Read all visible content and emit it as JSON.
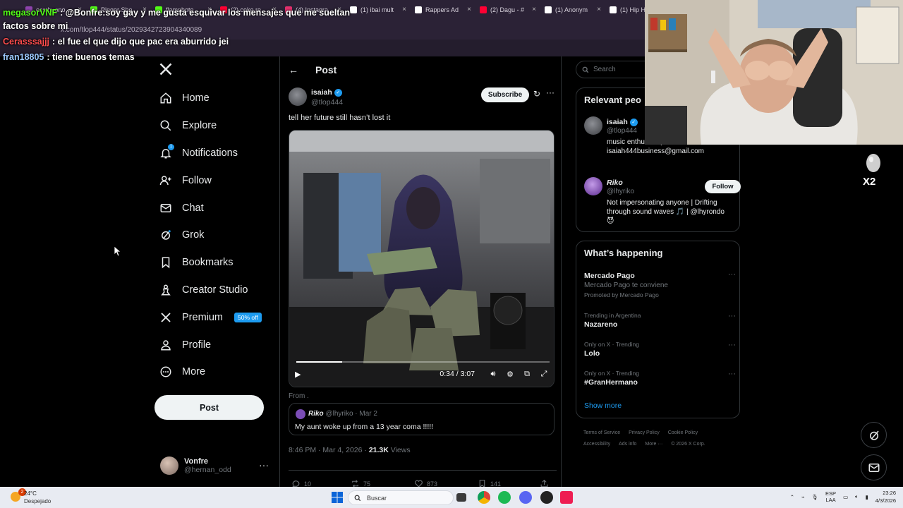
{
  "browser": {
    "tabs": [
      {
        "label": "ecstbuono",
        "color": "#8e44ad"
      },
      {
        "label": "Pinger Sho",
        "color": "#53fc18"
      },
      {
        "label": "flamphoto",
        "color": "#53fc18"
      },
      {
        "label": "(2) coke re",
        "color": "#ff0033"
      },
      {
        "label": "(4) Instagra",
        "color": "#e1306c"
      },
      {
        "label": "(1) ibai mult",
        "color": "#ffffff"
      },
      {
        "label": "Rappers Ad",
        "color": "#ffffff"
      },
      {
        "label": "(2) Dagu - #",
        "color": "#ff0033"
      },
      {
        "label": "(1) Anonym",
        "color": "#ffffff"
      },
      {
        "label": "(1) Hip Ho",
        "color": "#ffffff"
      }
    ],
    "url": "x.com/tlop444/status/2029342723904340089"
  },
  "chat": [
    {
      "user": "megasorVNF",
      "user_color": "#53fc18",
      "text": ": @Bonfre:soy gay y me gusta esquivar los mensajes que me sueltan factos sobre mi"
    },
    {
      "user": "Cerasssajjj",
      "user_color": "#ff4d4d",
      "text": ": el fue el que dijo que pac era aburrido jei"
    },
    {
      "user": "fran18805",
      "user_color": "#9ecbff",
      "text": ": tiene buenos temas"
    }
  ],
  "sidebar": {
    "items": [
      {
        "label": "Home",
        "icon": "home-icon"
      },
      {
        "label": "Explore",
        "icon": "search-icon"
      },
      {
        "label": "Notifications",
        "icon": "bell-icon",
        "badge": "1"
      },
      {
        "label": "Follow",
        "icon": "add-person-icon"
      },
      {
        "label": "Chat",
        "icon": "mail-icon"
      },
      {
        "label": "Grok",
        "icon": "grok-icon"
      },
      {
        "label": "Bookmarks",
        "icon": "bookmark-icon"
      },
      {
        "label": "Creator Studio",
        "icon": "creator-icon"
      },
      {
        "label": "Premium",
        "icon": "x-icon",
        "badge": "50% off"
      },
      {
        "label": "Profile",
        "icon": "person-icon"
      },
      {
        "label": "More",
        "icon": "more-circle-icon"
      }
    ],
    "post_label": "Post",
    "account": {
      "name": "Vonfre",
      "handle": "@hernan_odd"
    }
  },
  "post": {
    "header_title": "Post",
    "author_name": "isaiah",
    "author_handle": "@tlop444",
    "subscribe_label": "Subscribe",
    "text": "tell her future still hasn’t lost it",
    "video": {
      "time": "0:34 / 3:07",
      "progress": 0.18
    },
    "from_label": "From .",
    "quote": {
      "name": "Riko",
      "handle": "@lhyriko",
      "date": "· Mar 2",
      "text": "My aunt woke up from a 13 year coma !!!!!"
    },
    "meta_time": "8:46 PM · Mar 4, 2026 · ",
    "views_count": "21.3K",
    "views_label": " Views",
    "replies": "10",
    "reposts": "75",
    "likes": "873",
    "bookmarks": "141"
  },
  "right": {
    "search_placeholder": "Search",
    "relevant_title": "Relevant peo",
    "relevant": [
      {
        "name": "isaiah",
        "handle": "@tlop444",
        "bio": "music enthu... inquiries: isaiah444business@gmail.com"
      },
      {
        "name": "Riko",
        "handle": "@lhyriko",
        "bio": "Not impersonating anyone | Drifting through sound waves 🎵 | @lhyrondo 😈",
        "follow_label": "Follow"
      }
    ],
    "happening_title": "What’s happening",
    "trends": [
      {
        "context": "",
        "title": "Mercado Pago",
        "sub": "Mercado Pago te conviene",
        "promo": "Promoted by Mercado Pago"
      },
      {
        "context": "Trending in Argentina",
        "title": "Nazareno"
      },
      {
        "context": "Only on X · Trending",
        "title": "Lolo"
      },
      {
        "context": "Only on X · Trending",
        "title": "#GranHermano"
      }
    ],
    "show_more": "Show more",
    "footer": [
      "Terms of Service",
      "Privacy Policy",
      "Cookie Policy",
      "Accessibility",
      "Ads info",
      "More ···",
      "© 2026 X Corp."
    ]
  },
  "overlay": {
    "x2_label": "X2"
  },
  "taskbar": {
    "temp": "24°C",
    "weather": "Despejado",
    "notif_count": "2",
    "search_label": "Buscar",
    "lang1": "ESP",
    "lang2": "LAA",
    "time": "23:26",
    "date": "4/3/2026"
  }
}
